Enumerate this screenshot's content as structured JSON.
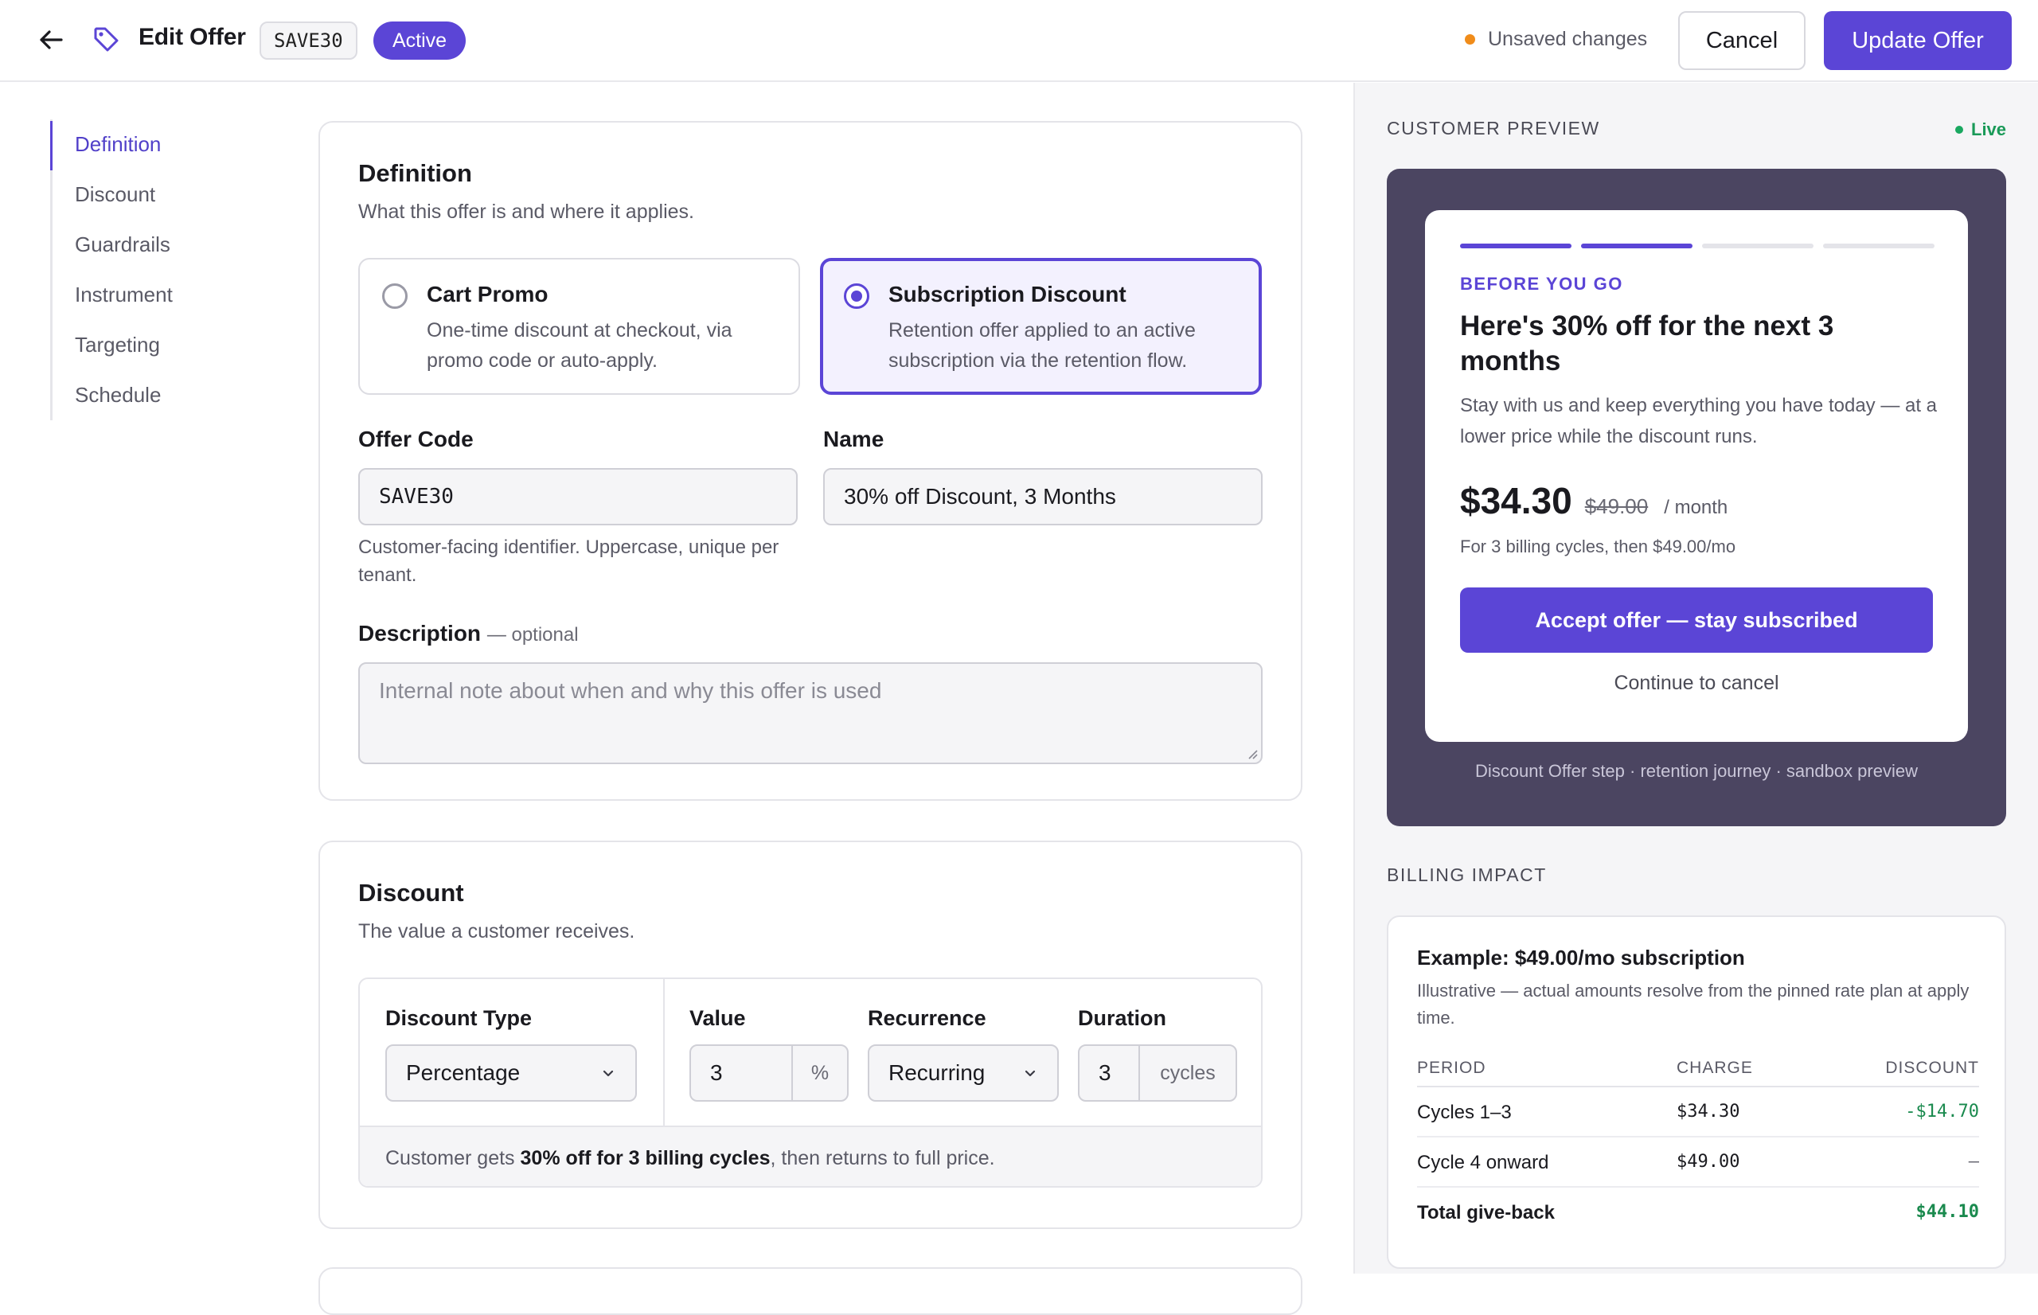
{
  "header": {
    "title": "Edit Offer",
    "code_chip": "SAVE30",
    "status": "Active",
    "unsaved": "Unsaved changes",
    "cancel_label": "Cancel",
    "update_label": "Update Offer",
    "colors": {
      "accent": "#5b45d6",
      "unsaved_dot": "#f08c1a"
    }
  },
  "nav": {
    "items": [
      {
        "label": "Definition",
        "active": true
      },
      {
        "label": "Discount"
      },
      {
        "label": "Guardrails"
      },
      {
        "label": "Instrument"
      },
      {
        "label": "Targeting"
      },
      {
        "label": "Schedule"
      }
    ]
  },
  "definition": {
    "title": "Definition",
    "subtitle": "What this offer is and where it applies.",
    "options": [
      {
        "title": "Cart Promo",
        "desc": "One-time discount at checkout, via promo code or auto-apply.",
        "selected": false
      },
      {
        "title": "Subscription Discount",
        "desc": "Retention offer applied to an active subscription via the retention flow.",
        "selected": true
      }
    ],
    "offer_code": {
      "label": "Offer Code",
      "value": "SAVE30",
      "help": "Customer-facing identifier. Uppercase, unique per tenant."
    },
    "name": {
      "label": "Name",
      "value": "30% off Discount, 3 Months"
    },
    "description": {
      "label": "Description",
      "optional": "— optional",
      "placeholder": "Internal note about when and why this offer is used"
    }
  },
  "discount": {
    "title": "Discount",
    "subtitle": "The value a customer receives.",
    "type_label": "Discount Type",
    "type_value": "Percentage",
    "value_label": "Value",
    "value": "3",
    "value_unit": "%",
    "recurrence_label": "Recurrence",
    "recurrence_value": "Recurring",
    "duration_label": "Duration",
    "duration_value": "3",
    "duration_unit": "cycles",
    "summary_pre": "Customer gets ",
    "summary_bold": "30% off for 3 billing cycles",
    "summary_post": ", then returns to full price."
  },
  "preview": {
    "heading": "CUSTOMER PREVIEW",
    "live": "Live",
    "steps": [
      true,
      true,
      false,
      false
    ],
    "eyebrow": "BEFORE YOU GO",
    "title": "Here's 30% off for the next 3 months",
    "body": "Stay with us and keep everything you have today — at a lower price while the discount runs.",
    "price_now": "$34.30",
    "price_was": "$49.00",
    "price_per": "/ month",
    "price_note": "For 3 billing cycles, then $49.00/mo",
    "accept_label": "Accept offer — stay subscribed",
    "continue_label": "Continue to cancel",
    "caption": "Discount Offer step · retention journey · sandbox preview",
    "colors": {
      "frame": "#4b4561",
      "live": "#1a9a58"
    }
  },
  "billing": {
    "heading": "BILLING IMPACT",
    "title": "Example: $49.00/mo subscription",
    "subtitle": "Illustrative — actual amounts resolve from the pinned rate plan at apply time.",
    "columns": [
      "PERIOD",
      "CHARGE",
      "DISCOUNT"
    ],
    "rows": [
      {
        "period": "Cycles 1–3",
        "charge": "$34.30",
        "discount": "-$14.70"
      },
      {
        "period": "Cycle 4 onward",
        "charge": "$49.00",
        "discount": "–"
      },
      {
        "period": "Total give-back",
        "charge": "",
        "discount": "$44.10"
      }
    ]
  }
}
